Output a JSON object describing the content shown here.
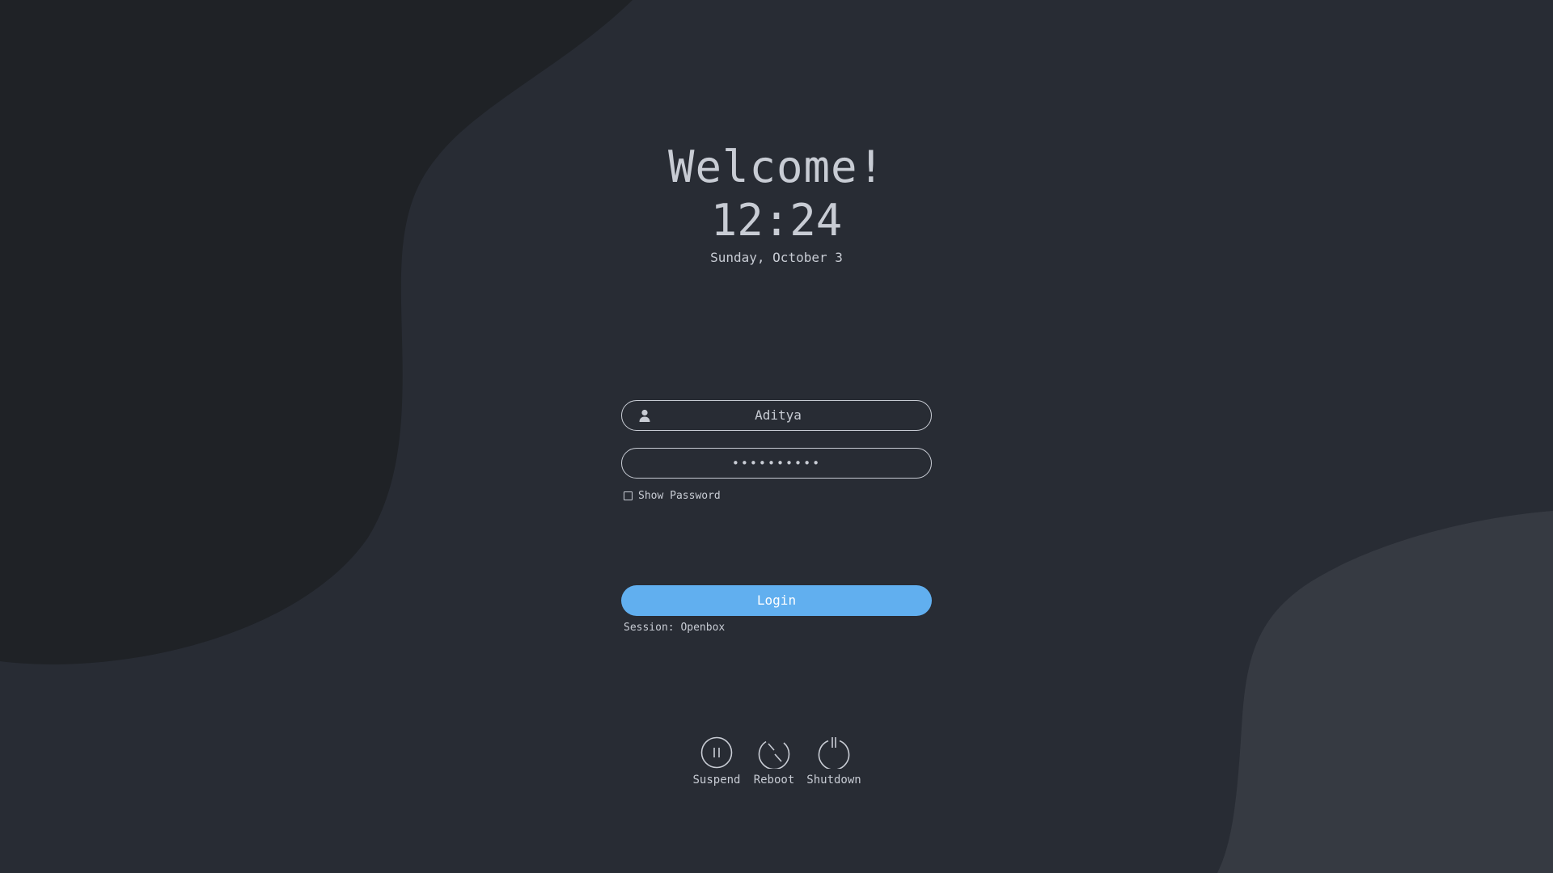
{
  "greeting": {
    "title": "Welcome!",
    "time": "12:24",
    "date": "Sunday, October 3"
  },
  "login_form": {
    "username_value": "Aditya",
    "username_icon": "user-icon",
    "password_masked": "••••••••••",
    "show_password_label": "Show Password",
    "show_password_checked": false,
    "login_label": "Login",
    "session_text": "Session: Openbox"
  },
  "power_actions": [
    {
      "label": "Suspend",
      "icon": "suspend-icon"
    },
    {
      "label": "Reboot",
      "icon": "reboot-icon"
    },
    {
      "label": "Shutdown",
      "icon": "shutdown-icon"
    }
  ],
  "colors": {
    "background": "#282c34",
    "blob_dark": "#1f2226",
    "blob_light": "#363a42",
    "text": "#c8ccd4",
    "accent": "#61afef"
  }
}
